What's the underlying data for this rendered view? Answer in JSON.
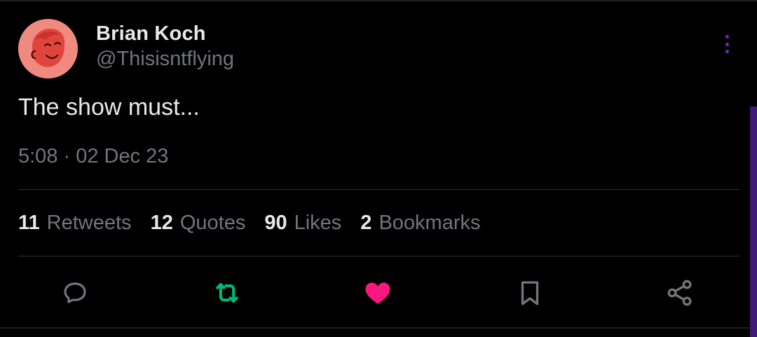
{
  "tweet": {
    "author": {
      "display_name": "Brian Koch",
      "handle": "@Thisisntflying",
      "avatar_color": "#f08a80"
    },
    "text": "The show must...",
    "timestamp": "5:08 · 02 Dec 23",
    "stats": [
      {
        "count": "11",
        "label": "Retweets"
      },
      {
        "count": "12",
        "label": "Quotes"
      },
      {
        "count": "90",
        "label": "Likes"
      },
      {
        "count": "2",
        "label": "Bookmarks"
      }
    ],
    "actions": {
      "reply": {
        "icon": "reply-icon",
        "color": "#71767b"
      },
      "retweet": {
        "icon": "retweet-icon",
        "color": "#00ba7c",
        "active": true
      },
      "like": {
        "icon": "heart-icon",
        "color": "#f91880",
        "active": true
      },
      "bookmark": {
        "icon": "bookmark-icon",
        "color": "#71767b"
      },
      "share": {
        "icon": "share-icon",
        "color": "#71767b"
      }
    },
    "more_menu_color": "#6b2fb3"
  }
}
